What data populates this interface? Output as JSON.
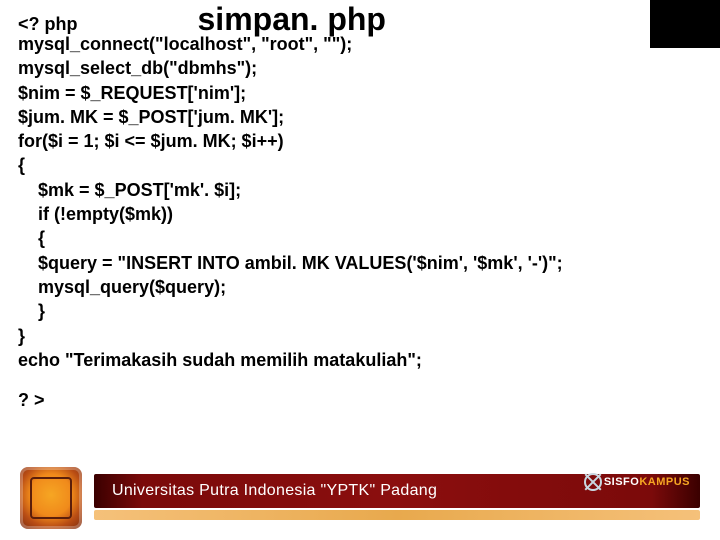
{
  "title": "simpan. php",
  "code": {
    "open_tag": "<? php",
    "lines": [
      "mysql_connect(\"localhost\", \"root\", \"\");",
      "mysql_select_db(\"dbmhs\");",
      "$nim = $_REQUEST['nim'];",
      "$jum. MK = $_POST['jum. MK'];",
      "for($i = 1; $i <= $jum. MK; $i++)",
      "{",
      "    $mk = $_POST['mk'. $i];",
      "    if (!empty($mk))",
      "    {",
      "    $query = \"INSERT INTO ambil. MK VALUES('$nim', '$mk', '-')\";",
      "    mysql_query($query);",
      "    }",
      "}",
      "echo \"Terimakasih sudah memilih matakuliah\";"
    ],
    "close_tag": "? >"
  },
  "footer": {
    "university": "Universitas Putra Indonesia \"YPTK\" Padang",
    "brand1": "SISFO",
    "brand2": "KAMPUS"
  }
}
